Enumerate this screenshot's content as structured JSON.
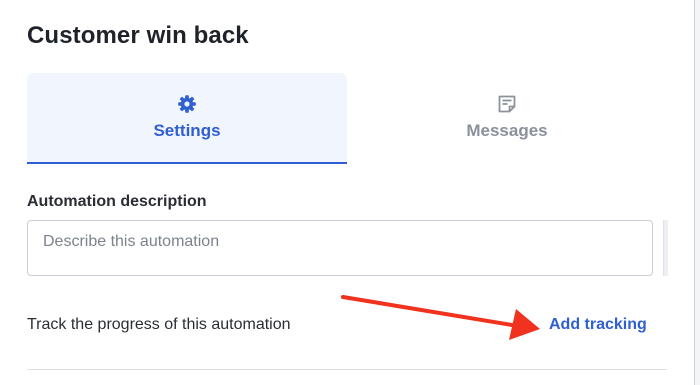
{
  "panel": {
    "title": "Customer win back"
  },
  "tabs": [
    {
      "label": "Settings",
      "icon": "gear-icon",
      "active": true
    },
    {
      "label": "Messages",
      "icon": "message-note-icon",
      "active": false
    }
  ],
  "description": {
    "label": "Automation description",
    "placeholder": "Describe this automation",
    "value": ""
  },
  "tracking": {
    "text": "Track the progress of this automation",
    "link_label": "Add tracking"
  },
  "colors": {
    "accent": "#2f5fd1",
    "active_tab_bg": "#f1f5fd",
    "annotation_arrow": "#f0321e"
  }
}
